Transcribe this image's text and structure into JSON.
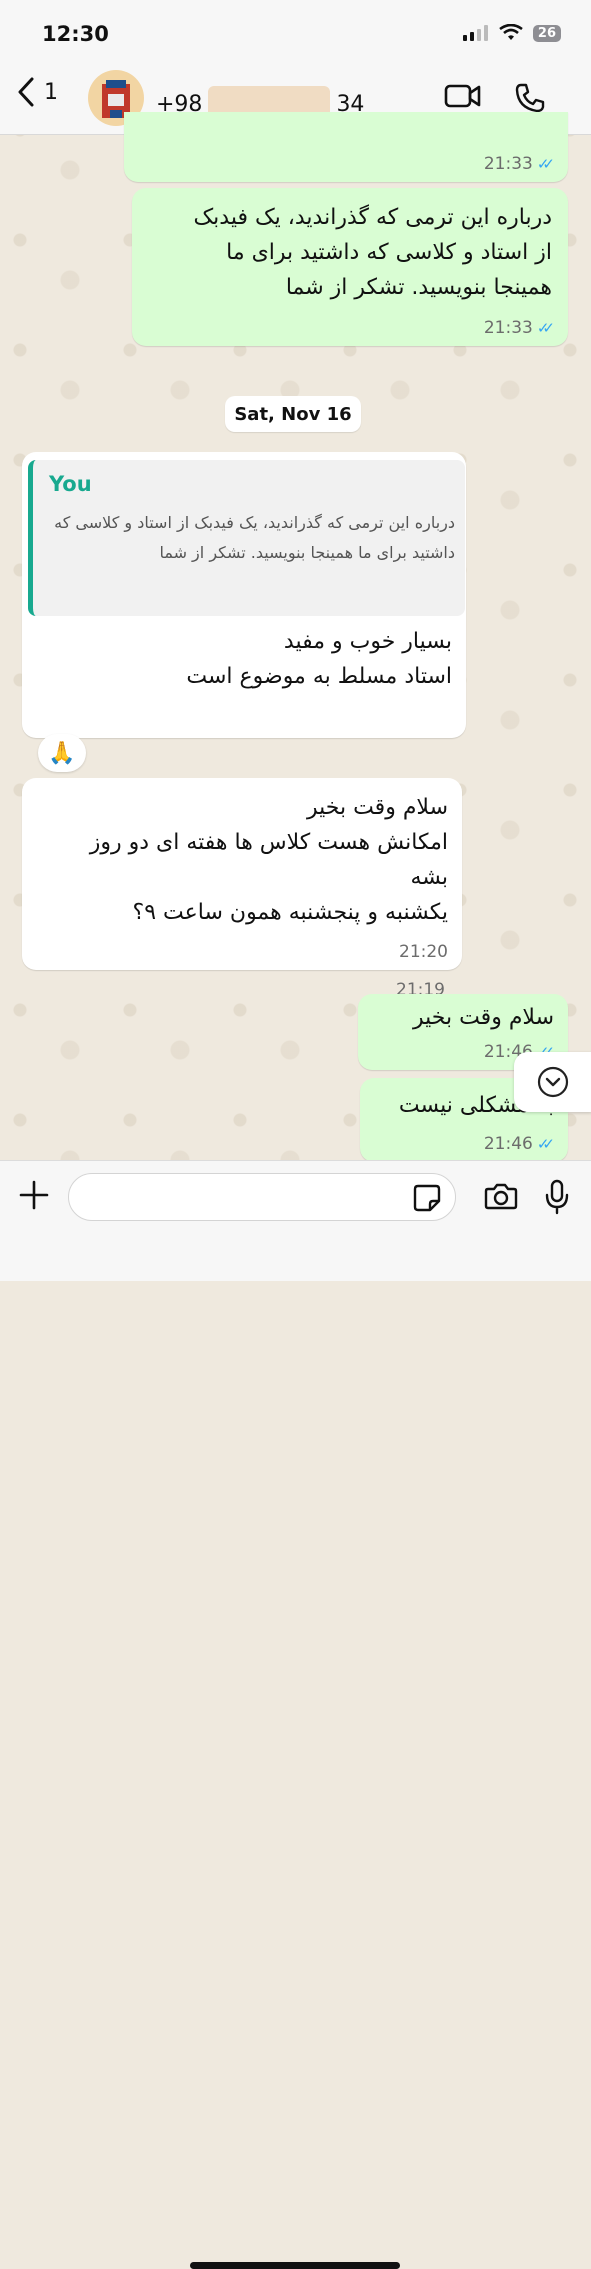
{
  "status": {
    "time": "12:30",
    "battery": "26"
  },
  "header": {
    "back_count": "1",
    "phone_prefix": "+98",
    "phone_suffix": "34"
  },
  "messages": [
    {
      "dir": "out",
      "text": "",
      "time": "21:33"
    },
    {
      "dir": "out",
      "text": "درباره این ترمی که گذراندید، یک فیدبک\nاز استاد و کلاسی که داشتید برای ما\nهمینجا بنویسید. تشکر از شما",
      "time": "21:33"
    },
    {
      "dir": "in",
      "text": "بسیار خوب و مفید\nاستاد مسلط به موضوع است",
      "time": "21:19"
    },
    {
      "dir": "in",
      "text": "سلام وقت بخیر\nامکانش هست کلاس ها هفته ای دو روز\nبشه\nیکشنبه و پنجشنبه همون ساعت ۹؟",
      "time": "21:20"
    },
    {
      "dir": "out",
      "text": "سلام وقت بخیر",
      "time": "21:46"
    },
    {
      "dir": "out",
      "text": "به مشکلی نیست",
      "time": "21:46"
    }
  ],
  "date_separator": "Sat, Nov 16",
  "quote": {
    "author": "You",
    "text": "درباره این ترمی که گذراندید، یک فیدبک از استاد و کلاسی که داشتید برای ما همینجا بنویسید. تشکر از شما"
  },
  "reaction": "🙏",
  "composer": {
    "placeholder": ""
  },
  "colors": {
    "outgoing": "#d9fdd3",
    "incoming": "#ffffff",
    "accent": "#18a98f",
    "ticks": "#35a5f3"
  },
  "icons": [
    "back-chevron-icon",
    "video-call-icon",
    "phone-icon",
    "plus-icon",
    "sticker-icon",
    "camera-icon",
    "mic-icon",
    "chevron-down-icon",
    "double-check-icon"
  ]
}
